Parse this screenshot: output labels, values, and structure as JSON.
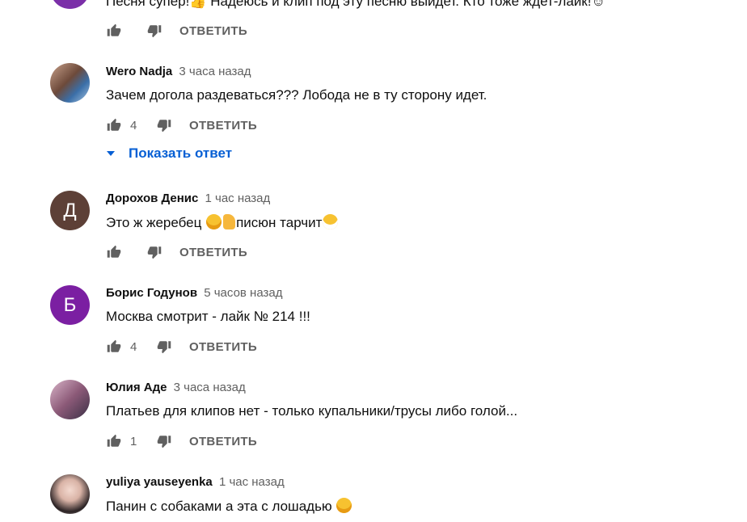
{
  "colors": {
    "link": "#065fd4",
    "muted": "#606060",
    "text": "#0f0f0f"
  },
  "reply_label": "ОТВЕТИТЬ",
  "comments": [
    {
      "author": "",
      "time": "",
      "text": "Песня супер!👍 Надеюсь и клип под эту песню выйдет. Кто тоже ждет-лайк!☺",
      "likes": "",
      "avatar_color": "#7b2fa8"
    },
    {
      "author": "Wero Nadja",
      "time": "3 часа назад",
      "text": "Зачем догола раздеваться??? Лобода не в ту сторону идет.",
      "likes": "4",
      "show_replies": "Показать ответ"
    },
    {
      "author": "Дорохов Денис",
      "time": "1 час назад",
      "text": "Это ж жеребец ",
      "text2": "писюн тарчит",
      "likes": "",
      "avatar_letter": "Д",
      "avatar_color": "#5d4037"
    },
    {
      "author": "Борис Годунов",
      "time": "5 часов назад",
      "text": "Москва смотрит - лайк № 214 !!!",
      "likes": "4",
      "avatar_letter": "Б",
      "avatar_color": "#7b1fa2"
    },
    {
      "author": "Юлия Аде",
      "time": "3 часа назад",
      "text": "Платьев для клипов нет - только купальники/трусы либо голой...",
      "likes": "1"
    },
    {
      "author": "yuliya yauseyenka",
      "time": "1 час назад",
      "text": "Панин с собаками а эта с лошадью",
      "likes": ""
    }
  ]
}
